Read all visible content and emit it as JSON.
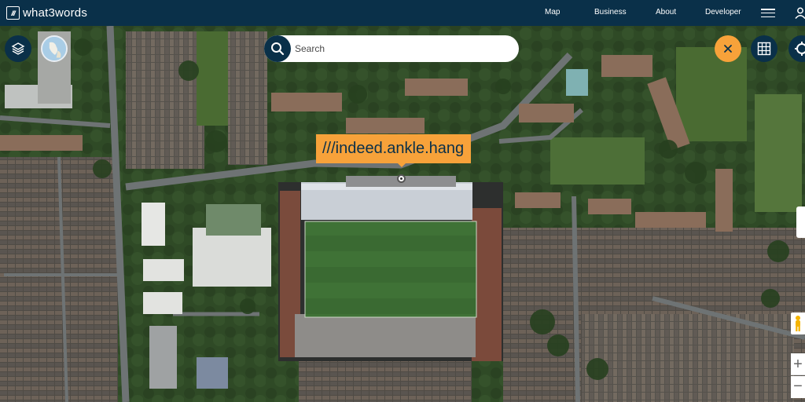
{
  "app": {
    "logo_text": "what3words",
    "logo_mark": "///"
  },
  "nav": {
    "items": [
      "Map",
      "Business",
      "About",
      "Developer"
    ]
  },
  "search": {
    "placeholder": "Search",
    "value": ""
  },
  "location": {
    "three_word_address": "///indeed.ankle.hang"
  },
  "map": {
    "type": "satellite",
    "zoom_in_label": "+",
    "zoom_out_label": "−"
  },
  "controls": {
    "icons": [
      "layers-icon",
      "globe-icon",
      "search-icon",
      "close-icon",
      "grid-icon",
      "locate-icon",
      "pegman-icon",
      "menu-icon",
      "user-icon"
    ]
  },
  "colors": {
    "nav_bg": "#0a3049",
    "accent": "#f7a23a",
    "pitch": "#3e6e34",
    "roof": "#c9cfd6"
  }
}
